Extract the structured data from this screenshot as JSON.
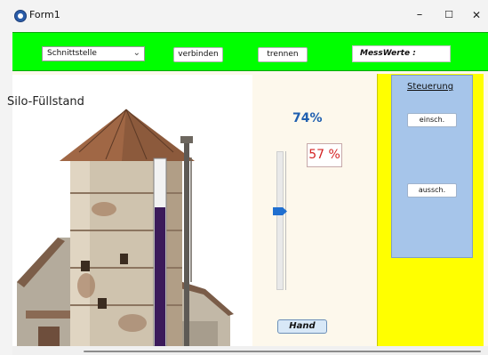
{
  "window": {
    "title": "Form1",
    "minimize_glyph": "–",
    "maximize_glyph": "☐",
    "close_glyph": "✕"
  },
  "toolbar": {
    "combo_value": "Schnittstelle",
    "connect_label": "verbinden",
    "disconnect_label": "trennen",
    "messwerte_label": "MessWerte :"
  },
  "silo": {
    "title": "Silo-Füllstand",
    "fill_fraction": 0.74
  },
  "level": {
    "percent_text": "74%",
    "setpoint_text": "57 %",
    "slider_fraction": 0.57,
    "mode_button": "Hand"
  },
  "control": {
    "title": "Steuerung",
    "on_label": "einsch.",
    "off_label": "aussch."
  },
  "colors": {
    "toolbar_bg": "#00ff00",
    "panel_yellow": "#ffff00",
    "panel_blue": "#a6c5ea",
    "level_fill": "#3b1a5a",
    "percent_blue": "#1f5fb0",
    "setpoint_red": "#d42424"
  }
}
